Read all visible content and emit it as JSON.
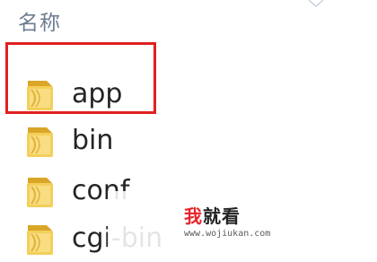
{
  "explorer": {
    "column_header": "名称",
    "files": [
      {
        "name": "app",
        "icon": "folder-icon",
        "partially_hidden": false
      },
      {
        "name": "bin",
        "icon": "folder-icon",
        "partially_hidden": false
      },
      {
        "name": "conf",
        "icon": "folder-icon",
        "partially_hidden": true
      },
      {
        "name": "cgi-bin",
        "icon": "folder-icon",
        "partially_hidden": true
      }
    ],
    "highlighted_item": "app"
  },
  "watermark": {
    "title_first": "我",
    "title_rest": "就看",
    "url": "www.wojiukan.com"
  },
  "colors": {
    "highlight_border": "#e02020",
    "header_text": "#6d7d91",
    "folder_front": "#f3cf5a",
    "folder_back": "#d9a628",
    "watermark_accent": "#e8232a"
  }
}
